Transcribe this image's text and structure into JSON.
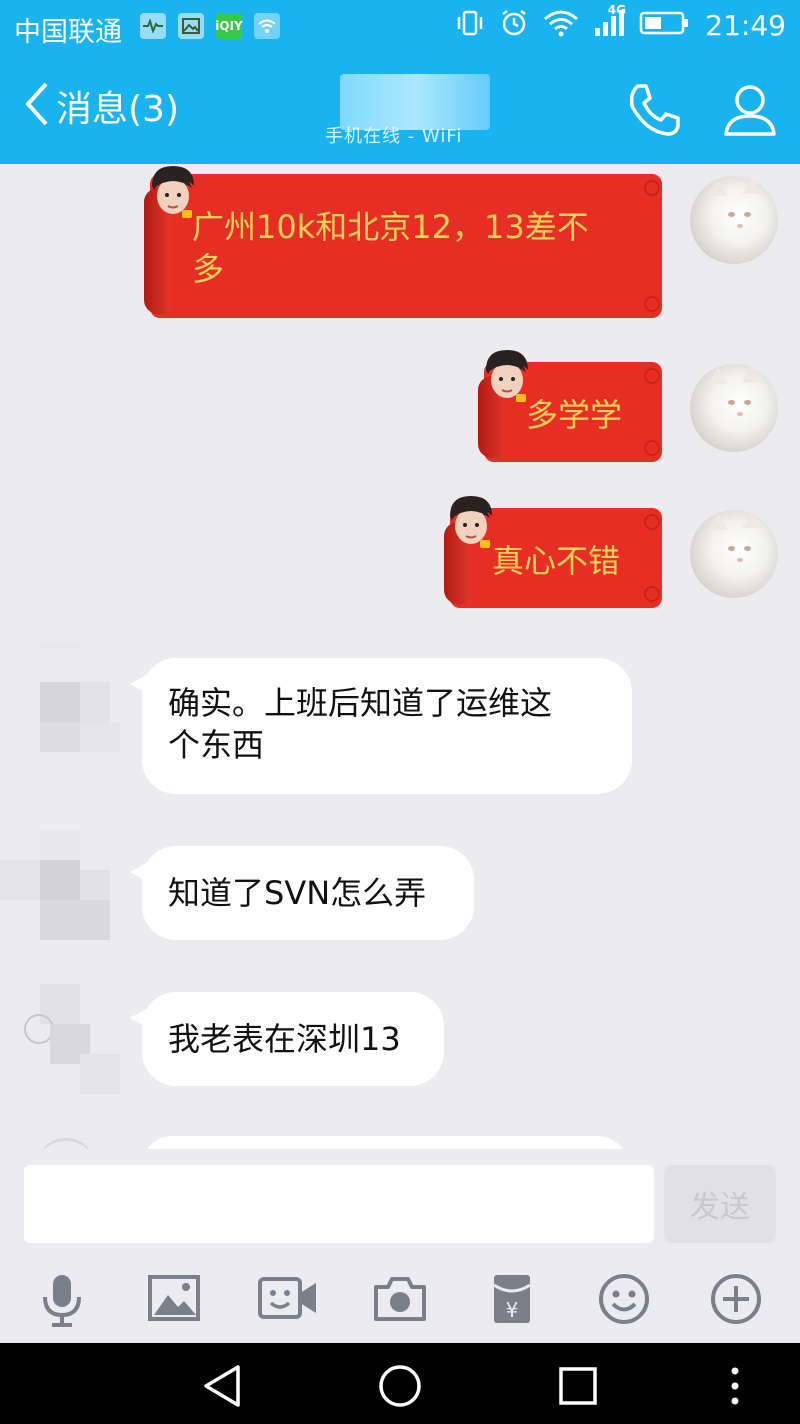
{
  "status_bar": {
    "carrier": "中国联通",
    "network": "4G",
    "time": "21:49",
    "left_icons": [
      "pulse-app-icon",
      "gallery-app-icon",
      "iqiyi-app-icon",
      "wifi-hotspot-icon"
    ],
    "right_icons": [
      "vibrate-icon",
      "alarm-icon",
      "wifi-icon",
      "signal-icon",
      "battery-icon"
    ]
  },
  "header": {
    "back_label": "消息(3)",
    "subtitle": "手机在线 - WiFi",
    "icons": [
      "back-arrow-icon",
      "phone-icon",
      "person-icon"
    ]
  },
  "messages": [
    {
      "side": "right",
      "style": "red-sticker-bubble",
      "text_line1": "广州10k和北京12，13差不",
      "text_line2": "多"
    },
    {
      "side": "right",
      "style": "red-sticker-bubble",
      "text": "多学学"
    },
    {
      "side": "right",
      "style": "red-sticker-bubble",
      "text": "真心不错"
    },
    {
      "side": "left",
      "style": "white-bubble",
      "text_line1": "确实。上班后知道了运维这",
      "text_line2": "个东西"
    },
    {
      "side": "left",
      "style": "white-bubble",
      "text": "知道了SVN怎么弄"
    },
    {
      "side": "left",
      "style": "white-bubble",
      "text": "我老表在深圳13"
    }
  ],
  "input": {
    "value": "",
    "placeholder": "",
    "send_label": "发送"
  },
  "toolbar": {
    "icons": [
      "microphone-icon",
      "image-icon",
      "video-icon",
      "camera-icon",
      "red-packet-icon",
      "emoji-icon",
      "plus-icon"
    ]
  },
  "nav_bar": {
    "icons": [
      "back-triangle-icon",
      "home-circle-icon",
      "recents-square-icon",
      "more-dots-icon"
    ]
  },
  "colors": {
    "brand": "#19b4f0",
    "chat_bg": "#ebebf0",
    "red_bubble": "#e62e24",
    "red_bubble_text": "#ffd35a"
  }
}
